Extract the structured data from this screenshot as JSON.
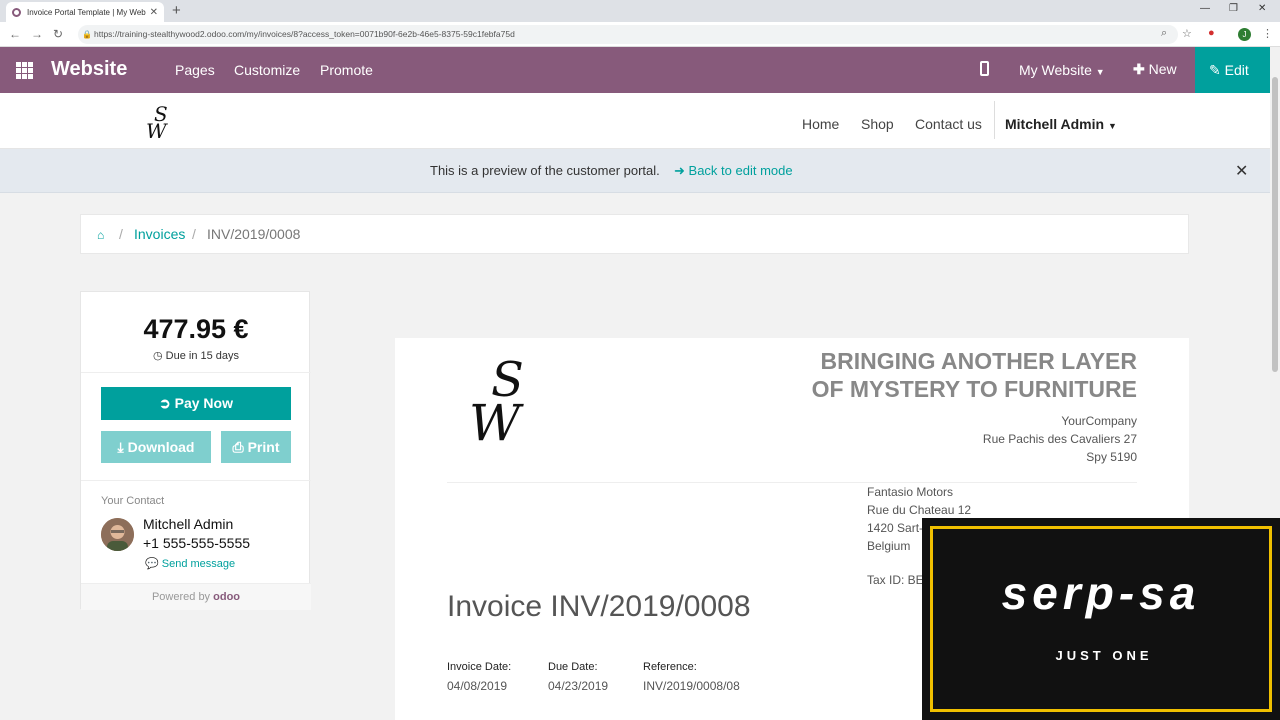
{
  "browser": {
    "tab_title": "Invoice Portal Template | My Website",
    "url": "https://training-stealthywood2.odoo.com/my/invoices/8?access_token=0071b90f-6e2b-46e5-8375-59c1febfa75d",
    "profile_initial": "J"
  },
  "website_bar": {
    "brand": "Website",
    "menu": [
      "Pages",
      "Customize",
      "Promote"
    ],
    "my_website": "My Website",
    "new_label": "New",
    "edit_label": "Edit",
    "color": "#875a7b",
    "accent": "#00a09d"
  },
  "site_header": {
    "nav": [
      "Home",
      "Shop",
      "Contact us"
    ],
    "user": "Mitchell Admin"
  },
  "preview_banner": {
    "message": "This is a preview of the customer portal.",
    "back_link": "Back to edit mode"
  },
  "breadcrumb": {
    "items": [
      "Invoices",
      "INV/2019/0008"
    ]
  },
  "sidebar": {
    "amount": "477.95 €",
    "due": "Due in 15 days",
    "pay_now": "Pay Now",
    "download": "Download",
    "print": "Print",
    "your_contact": "Your Contact",
    "contact_name": "Mitchell Admin",
    "contact_phone": "+1 555-555-5555",
    "send_message": "Send message",
    "powered_by": "Powered by",
    "powered_brand": "odoo"
  },
  "invoice": {
    "tagline_1": "BRINGING ANOTHER LAYER",
    "tagline_2": "OF MYSTERY TO FURNITURE",
    "company_lines": [
      "YourCompany",
      "Rue Pachis des Cavaliers 27",
      "Spy 5190"
    ],
    "customer_lines": [
      "Fantasio Motors",
      "Rue du Chateau 12",
      "1420 Sart-",
      "Belgium"
    ],
    "tax_id": "Tax ID: BE",
    "title": "Invoice INV/2019/0008",
    "invoice_date_label": "Invoice Date:",
    "invoice_date": "04/08/2019",
    "due_date_label": "Due Date:",
    "due_date": "04/23/2019",
    "reference_label": "Reference:",
    "reference": "INV/2019/0008/08"
  },
  "overlay": {
    "word": "serp-sa",
    "sub": "JUST ONE"
  }
}
